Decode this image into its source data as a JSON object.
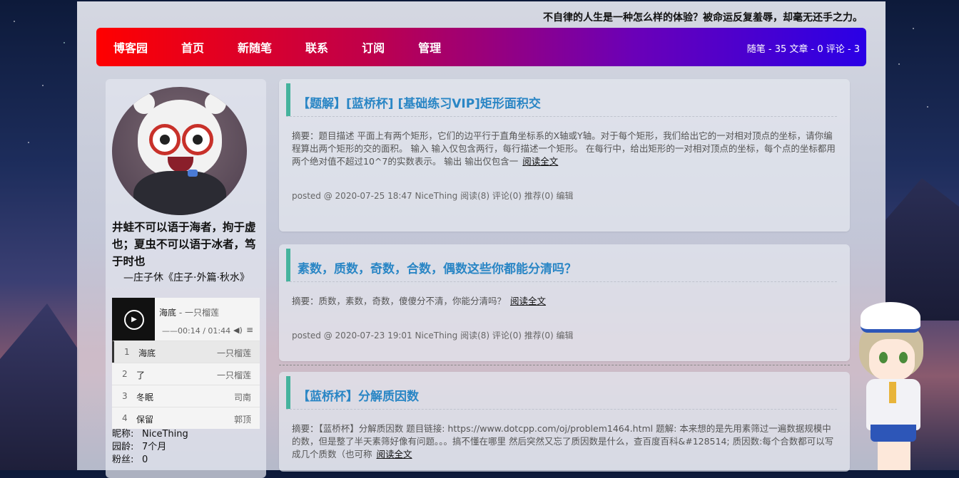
{
  "header": {
    "slogan": "不自律的人生是一种怎么样的体验？被命运反复羞辱，却毫无还手之力。"
  },
  "nav": {
    "items": [
      "博客园",
      "首页",
      "新随笔",
      "联系",
      "订阅",
      "管理"
    ],
    "stats": "随笔 - 35  文章 - 0  评论 - 3"
  },
  "sidebar": {
    "quote": "井蛙不可以语于海者，拘于虚也；夏虫不可以语于冰者，笃于时也",
    "quote_source": "—庄子休《庄子·外篇·秋水》",
    "player": {
      "title": "海底",
      "artist": " - 一只榴莲",
      "time": "——00:14 / 01:44"
    },
    "playlist": [
      {
        "num": "1",
        "name": "海底",
        "artist": "一只榴莲"
      },
      {
        "num": "2",
        "name": "了",
        "artist": "一只榴莲"
      },
      {
        "num": "3",
        "name": "冬眠",
        "artist": "司南"
      },
      {
        "num": "4",
        "name": "保留",
        "artist": "郭顶"
      }
    ],
    "profile": {
      "nickname_label": "昵称:",
      "nickname": "NiceThing",
      "age_label": "园龄:",
      "age": "7个月",
      "fans_label": "粉丝:",
      "fans": "0"
    }
  },
  "posts": [
    {
      "title": "【题解】[蓝桥杯] [基础练习VIP]矩形面积交",
      "summary": "摘要：题目描述 平面上有两个矩形，它们的边平行于直角坐标系的X轴或Y轴。对于每个矩形，我们给出它的一对相对顶点的坐标，请你编程算出两个矩形的交的面积。 输入 输入仅包含两行，每行描述一个矩形。 在每行中，给出矩形的一对相对顶点的坐标，每个点的坐标都用两个绝对值不超过10^7的实数表示。 输出 输出仅包含一",
      "read_more": "阅读全文",
      "meta": "posted @ 2020-07-25 18:47 NiceThing 阅读(8) 评论(0) 推荐(0) ",
      "edit": "编辑"
    },
    {
      "title": "素数，质数，奇数，合数，偶数这些你都能分清吗？",
      "summary": "摘要：质数，素数，奇数，傻傻分不清，你能分清吗？",
      "read_more": "阅读全文",
      "meta": "posted @ 2020-07-23 19:01 NiceThing 阅读(8) 评论(0) 推荐(0) ",
      "edit": "编辑"
    },
    {
      "title": "【蓝桥杯】分解质因数",
      "summary": "摘要：【蓝桥杯】分解质因数 题目链接: https://www.dotcpp.com/oj/problem1464.html 题解: 本来想的是先用素筛过一遍数据规模中的数，但是整了半天素筛好像有问题。。。搞不懂在哪里 然后突然又忘了质因数是什么，查百度百科&#128514; 质因数:每个合数都可以写成几个质数（也可称",
      "read_more": "阅读全文"
    }
  ]
}
